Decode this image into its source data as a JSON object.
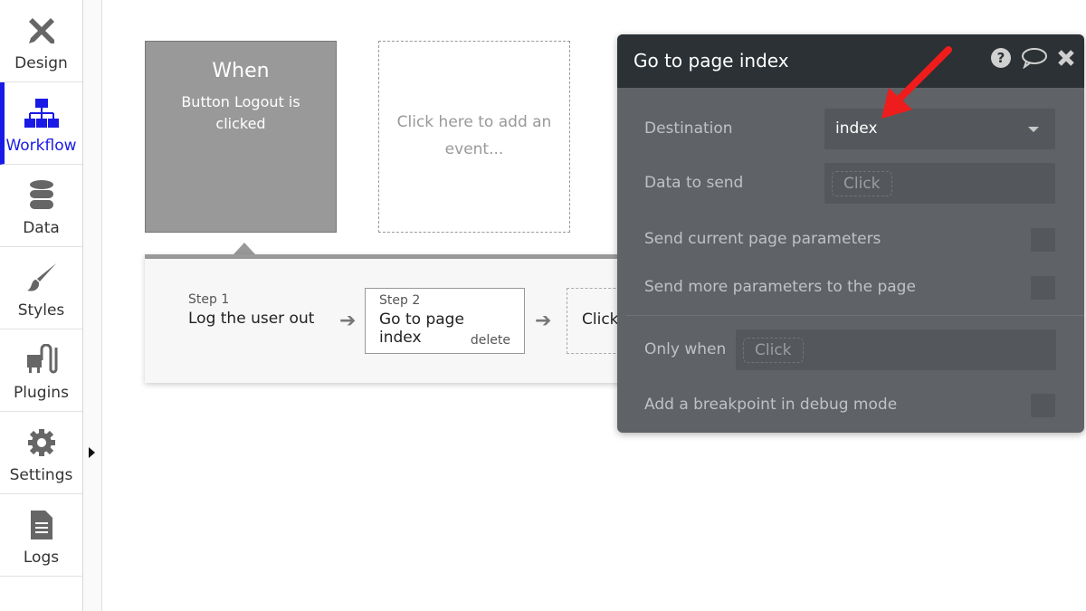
{
  "sidebar": {
    "items": [
      {
        "label": "Design",
        "icon": "design-tools-icon"
      },
      {
        "label": "Workflow",
        "icon": "workflow-hierarchy-icon",
        "active": true
      },
      {
        "label": "Data",
        "icon": "database-icon"
      },
      {
        "label": "Styles",
        "icon": "brush-icon"
      },
      {
        "label": "Plugins",
        "icon": "plug-icon"
      },
      {
        "label": "Settings",
        "icon": "gear-icon"
      },
      {
        "label": "Logs",
        "icon": "document-icon"
      }
    ]
  },
  "colors": {
    "accent": "#1a1ae6",
    "panel_header": "#2b3134",
    "panel_body": "#5f6367",
    "annotation_arrow": "#ee1c1c"
  },
  "event": {
    "title": "When",
    "description": "Button Logout is clicked"
  },
  "add_event": "Click here to add an event...",
  "steps": [
    {
      "step": "Step 1",
      "title": "Log the user out"
    },
    {
      "step": "Step 2",
      "title": "Go to page index",
      "delete": "delete"
    },
    {
      "title": "Click"
    }
  ],
  "panel": {
    "title": "Go to page index",
    "destination_label": "Destination",
    "destination_value": "index",
    "data_label": "Data to send",
    "data_placeholder": "Click",
    "send_current_label": "Send current page parameters",
    "send_more_label": "Send more parameters to the page",
    "only_when_label": "Only when",
    "only_when_placeholder": "Click",
    "breakpoint_label": "Add a breakpoint in debug mode"
  }
}
